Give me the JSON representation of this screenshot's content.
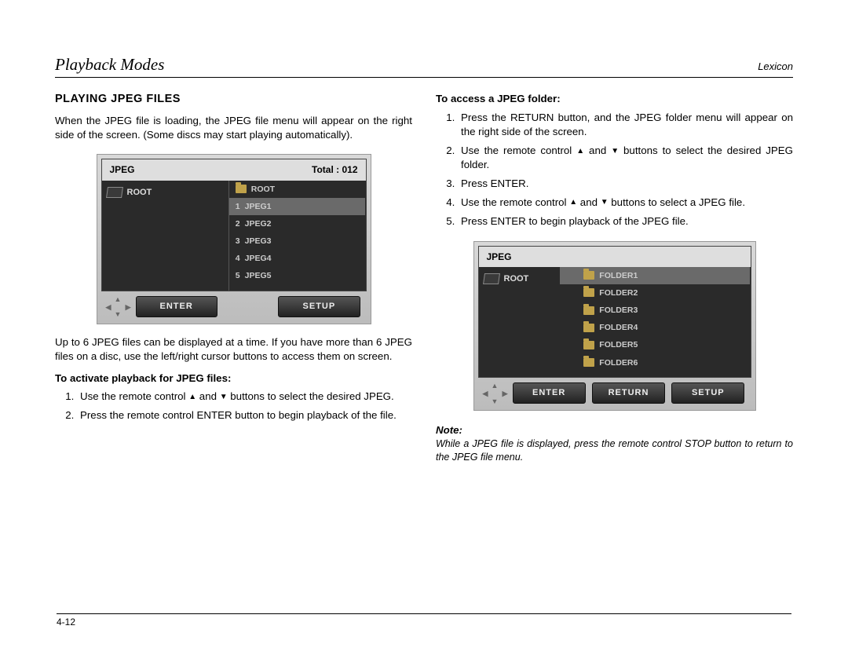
{
  "header": {
    "left": "Playback Modes",
    "right": "Lexicon"
  },
  "left_col": {
    "title": "PLAYING JPEG FILES",
    "intro": "When the JPEG file is loading, the JPEG file menu will appear on the right side of the screen. (Some discs may start playing automatically).",
    "below_img": "Up to 6 JPEG files can be displayed at a time. If you have more than 6 JPEG files on a disc, use the left/right cursor buttons to access them on screen.",
    "sub": "To activate playback for JPEG files:",
    "steps": {
      "s1a": "Use the remote control ",
      "s1b": " and ",
      "s1c": " buttons to select the desired JPEG.",
      "s2": "Press the remote control ENTER button to begin playback of the file."
    }
  },
  "right_col": {
    "sub": "To access a JPEG folder:",
    "steps": {
      "s1": "Press the RETURN button, and the JPEG folder menu will appear on the right side of the screen.",
      "s2a": "Use the remote control ",
      "s2b": " and ",
      "s2c": " buttons to select the desired JPEG folder.",
      "s3": "Press ENTER.",
      "s4a": "Use the remote control ",
      "s4b": " and ",
      "s4c": " buttons to select a JPEG file.",
      "s5": "Press ENTER to begin playback of the JPEG file."
    },
    "note_label": "Note:",
    "note_text": "While a JPEG file is displayed, press the remote control STOP button to return to the JPEG file menu."
  },
  "ss1": {
    "title_left": "JPEG",
    "title_right": "Total : 012",
    "left_label": "ROOT",
    "rows": [
      {
        "icon": true,
        "num": "",
        "label": "ROOT",
        "sel": false
      },
      {
        "icon": false,
        "num": "1",
        "label": "JPEG1",
        "sel": true
      },
      {
        "icon": false,
        "num": "2",
        "label": "JPEG2",
        "sel": false
      },
      {
        "icon": false,
        "num": "3",
        "label": "JPEG3",
        "sel": false
      },
      {
        "icon": false,
        "num": "4",
        "label": "JPEG4",
        "sel": false
      },
      {
        "icon": false,
        "num": "5",
        "label": "JPEG5",
        "sel": false
      }
    ],
    "btn_enter": "ENTER",
    "btn_setup": "SETUP"
  },
  "ss2": {
    "title_left": "JPEG",
    "left_label": "ROOT",
    "rows": [
      {
        "label": "FOLDER1",
        "sel": true
      },
      {
        "label": "FOLDER2",
        "sel": false
      },
      {
        "label": "FOLDER3",
        "sel": false
      },
      {
        "label": "FOLDER4",
        "sel": false
      },
      {
        "label": "FOLDER5",
        "sel": false
      },
      {
        "label": "FOLDER6",
        "sel": false
      }
    ],
    "btn_enter": "ENTER",
    "btn_return": "RETURN",
    "btn_setup": "SETUP"
  },
  "page_num": "4-12"
}
